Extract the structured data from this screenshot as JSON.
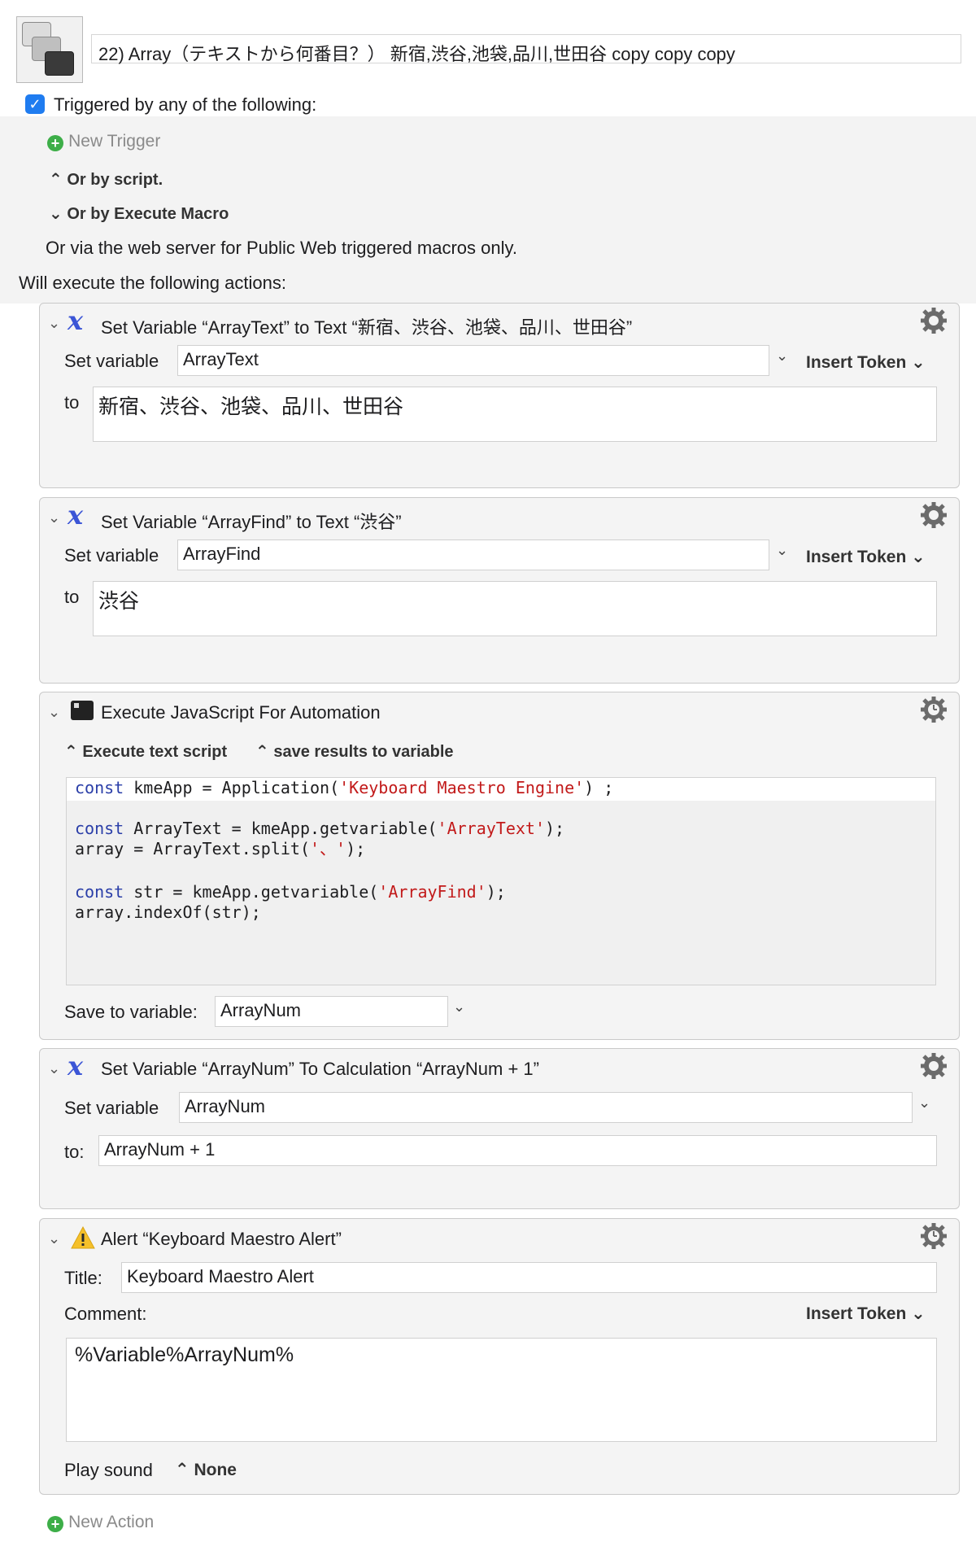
{
  "macro": {
    "name": "22) Array（テキストから何番目？） 新宿,渋谷,池袋,品川,世田谷 copy copy copy"
  },
  "triggers": {
    "enabled_label": "Triggered by any of the following:",
    "new_trigger": "New Trigger",
    "or_by_script": "Or by script.",
    "or_by_execute_macro": "Or by Execute Macro",
    "web_server_note": "Or via the web server for Public Web triggered macros only."
  },
  "actions_heading": "Will execute the following actions:",
  "actions": [
    {
      "title": "Set Variable “ArrayText” to Text “新宿、渋谷、池袋、品川、世田谷”",
      "set_variable_label": "Set variable",
      "variable": "ArrayText",
      "insert_token": "Insert Token",
      "to_label": "to",
      "value": "新宿、渋谷、池袋、品川、世田谷"
    },
    {
      "title": "Set Variable “ArrayFind” to Text “渋谷”",
      "set_variable_label": "Set variable",
      "variable": "ArrayFind",
      "insert_token": "Insert Token",
      "to_label": "to",
      "value": "渋谷"
    },
    {
      "title": "Execute JavaScript For Automation",
      "mode": "Execute text script",
      "results": "save results to variable",
      "code": {
        "l1_kw": "const",
        "l1_a": " kmeApp = Application(",
        "l1_str": "'Keyboard Maestro Engine'",
        "l1_b": ") ;",
        "l2_kw": "const",
        "l2_a": " ArrayText = kmeApp.getvariable(",
        "l2_str": "'ArrayText'",
        "l2_b": ");",
        "l3_a": "array = ArrayText.split(",
        "l3_str": "'、'",
        "l3_b": ");",
        "l4_kw": "const",
        "l4_a": " str = kmeApp.getvariable(",
        "l4_str": "'ArrayFind'",
        "l4_b": ");",
        "l5_a": "array.indexOf(str);"
      },
      "save_to_label": "Save to variable:",
      "save_to_value": "ArrayNum"
    },
    {
      "title": "Set Variable “ArrayNum” To Calculation “ArrayNum + 1”",
      "set_variable_label": "Set variable",
      "variable": "ArrayNum",
      "to_label": "to:",
      "value": "ArrayNum + 1"
    },
    {
      "title": "Alert “Keyboard Maestro Alert”",
      "title_label": "Title:",
      "title_value": "Keyboard Maestro Alert",
      "comment_label": "Comment:",
      "insert_token": "Insert Token",
      "comment_value": "%Variable%ArrayNum%",
      "play_sound_label": "Play sound",
      "play_sound_value": "None"
    }
  ],
  "new_action": "New Action",
  "colors": {
    "checkbox": "#1f7cf0",
    "plus": "#3dae48",
    "variable_icon": "#3b55d6",
    "alert": "#f5c02a"
  },
  "icons": [
    "macro-icon",
    "checkbox-icon",
    "plus-circle-icon",
    "updown-chevron-icon",
    "chevron-down-icon",
    "variable-x-icon",
    "gear-icon",
    "terminal-icon",
    "timer-gear-icon",
    "warning-icon"
  ]
}
